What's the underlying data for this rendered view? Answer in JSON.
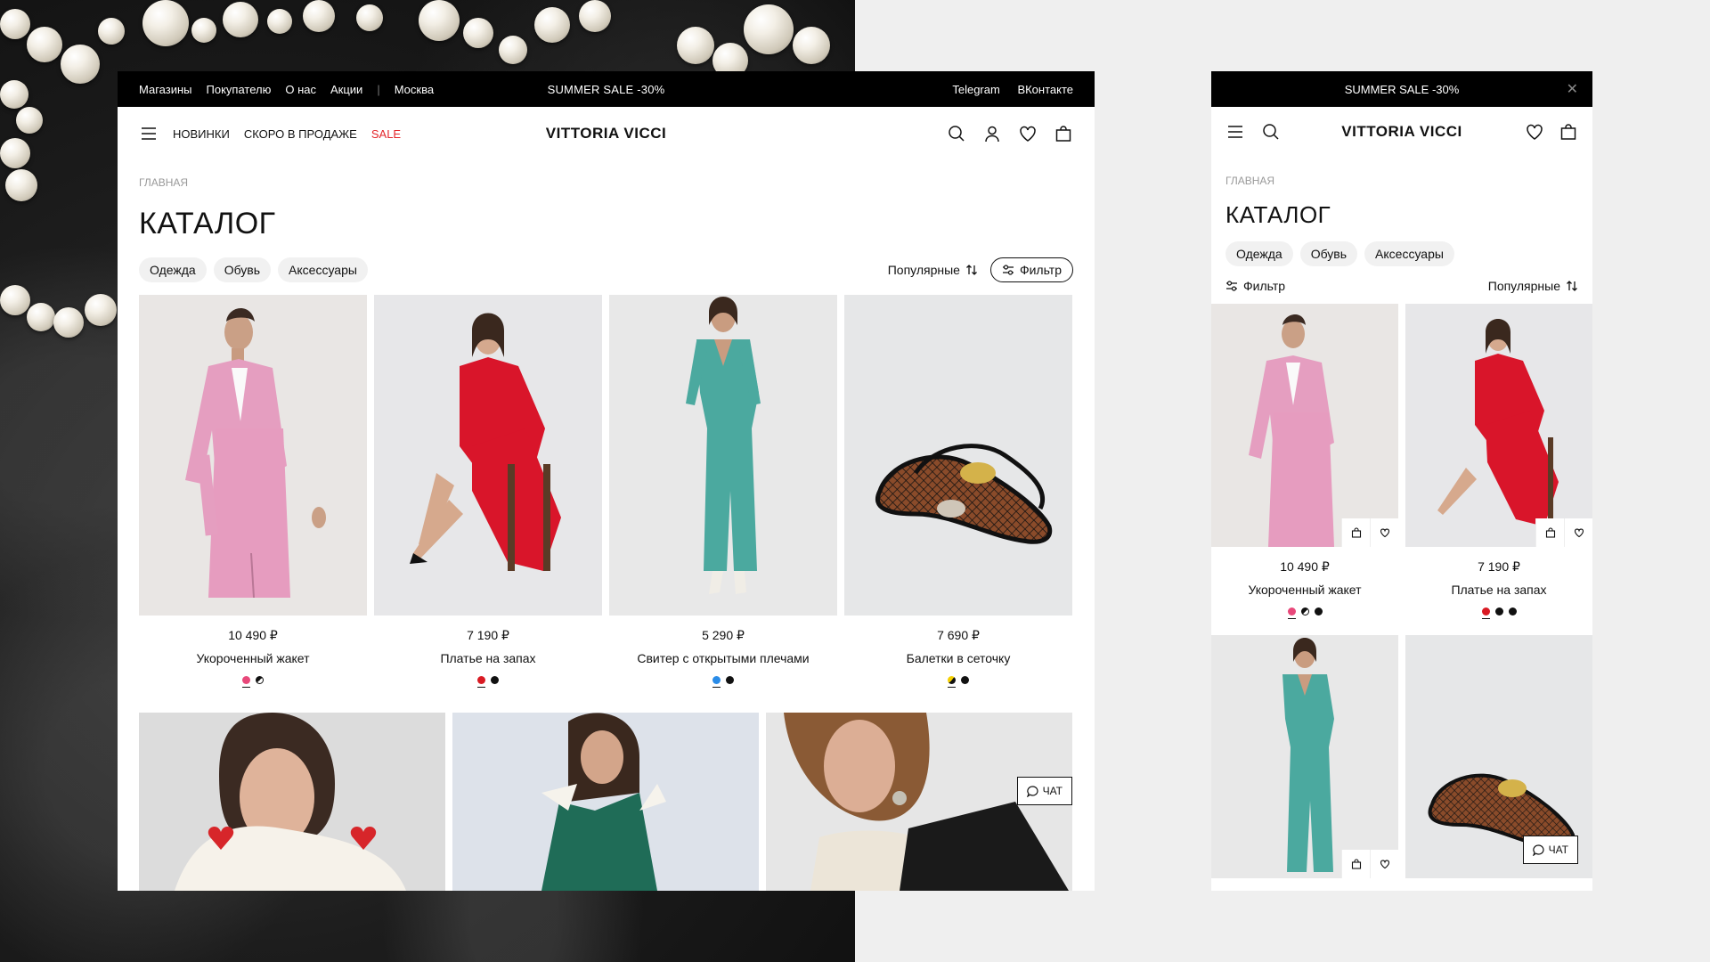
{
  "desktop": {
    "topbar": {
      "links": [
        "Магазины",
        "Покупателю",
        "О нас",
        "Акции"
      ],
      "city": "Москва",
      "promo": "SUMMER SALE -30%",
      "social": [
        "Telegram",
        "ВКонтакте"
      ]
    },
    "nav": {
      "new": "НОВИНКИ",
      "soon": "СКОРО В ПРОДАЖЕ",
      "sale": "SALE"
    },
    "logo": "VITTORIA VICCI",
    "breadcrumb": "ГЛАВНАЯ",
    "title": "КАТАЛОГ",
    "chips": [
      "Одежда",
      "Обувь",
      "Аксессуары"
    ],
    "sort_label": "Популярные",
    "filter_label": "Фильтр",
    "products": [
      {
        "price": "10 490 ₽",
        "name": "Укороченный жакет"
      },
      {
        "price": "7 190 ₽",
        "name": "Платье на запах"
      },
      {
        "price": "5 290 ₽",
        "name": "Свитер с открытыми плечами"
      },
      {
        "price": "7 690 ₽",
        "name": "Балетки в сеточку"
      }
    ],
    "chat_label": "ЧАТ"
  },
  "mobile": {
    "promo": "SUMMER SALE -30%",
    "logo": "VITTORIA VICCI",
    "breadcrumb": "ГЛАВНАЯ",
    "title": "КАТАЛОГ",
    "chips": [
      "Одежда",
      "Обувь",
      "Аксессуары"
    ],
    "filter_label": "Фильтр",
    "sort_label": "Популярные",
    "products": [
      {
        "price": "10 490 ₽",
        "name": "Укороченный жакет"
      },
      {
        "price": "7 190 ₽",
        "name": "Платье на запах"
      }
    ],
    "chat_label": "ЧАТ"
  },
  "colors": {
    "sale_red": "#e3262b",
    "pink": "#e8487a",
    "red": "#d91a23",
    "blue": "#2a8ce8",
    "black": "#111111",
    "yellow": "#f5d000"
  }
}
